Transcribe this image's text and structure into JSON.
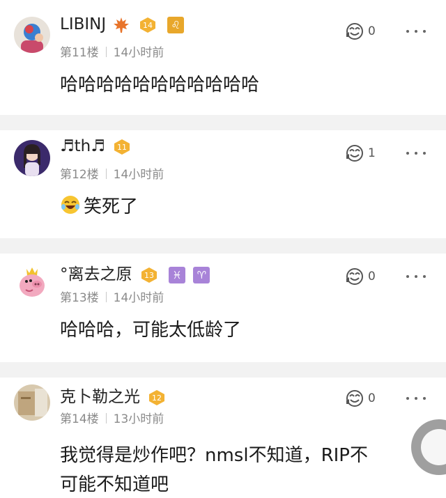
{
  "comments": [
    {
      "username": "LIBINJ",
      "level": "14",
      "floor": "第11楼",
      "time": "14小时前",
      "text": "哈哈哈哈哈哈哈哈哈哈哈",
      "likes": "0",
      "avatar_color": "#d9434d"
    },
    {
      "username": "♬th♬",
      "level": "11",
      "floor": "第12楼",
      "time": "14小时前",
      "text": "笑死了",
      "likes": "1",
      "avatar_color": "#5a3b8c"
    },
    {
      "username": "°离去之原",
      "level": "13",
      "floor": "第13楼",
      "time": "14小时前",
      "text": "哈哈哈，可能太低龄了",
      "likes": "0",
      "signs": [
        "♓",
        "♈"
      ],
      "avatar_color": "#f2a9bf"
    },
    {
      "username": "克卜勒之光",
      "level": "12",
      "floor": "第14楼",
      "time": "13小时前",
      "text_line1": "我觉得是炒作吧？nmsl不知道，RIP不",
      "text_line2": "可能不知道吧",
      "likes": "0",
      "avatar_color": "#c9b596"
    }
  ],
  "first_comment_sign": "♌",
  "colors": {
    "badge": "#f3b233",
    "separator": "#f2f2f2",
    "meta": "#8a8a8a"
  },
  "icons": [
    "like-icon",
    "more-icon",
    "level-badge-icon",
    "maple-leaf-icon",
    "laugh-emoji-icon"
  ]
}
